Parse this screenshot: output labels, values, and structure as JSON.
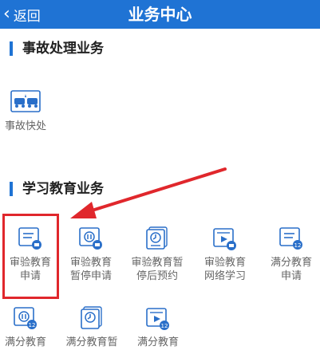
{
  "header": {
    "back_label": "返回",
    "title": "业务中心",
    "colors": {
      "bar": "#1f73d4",
      "text": "#ffffff"
    }
  },
  "sections": [
    {
      "title": "事故处理业务",
      "items": [
        {
          "label": "事故快处",
          "icon": "car-accident-icon"
        }
      ]
    },
    {
      "title": "学习教育业务",
      "items": [
        {
          "label": "审验教育申请",
          "icon": "document-badge-icon"
        },
        {
          "label": "审验教育暂停申请",
          "icon": "pause-badge-icon"
        },
        {
          "label": "审验教育暂停后预约",
          "icon": "clock-document-icon"
        },
        {
          "label": "审验教育网络学习",
          "icon": "video-play-icon"
        },
        {
          "label": "满分教育申请",
          "icon": "document-12-icon"
        },
        {
          "label": "满分教育",
          "icon": "pause-12-icon"
        },
        {
          "label": "满分教育暂",
          "icon": "clock-document-icon"
        },
        {
          "label": "满分教育",
          "icon": "video-play-icon"
        }
      ]
    }
  ],
  "annotation": {
    "color": "#e0272c"
  }
}
